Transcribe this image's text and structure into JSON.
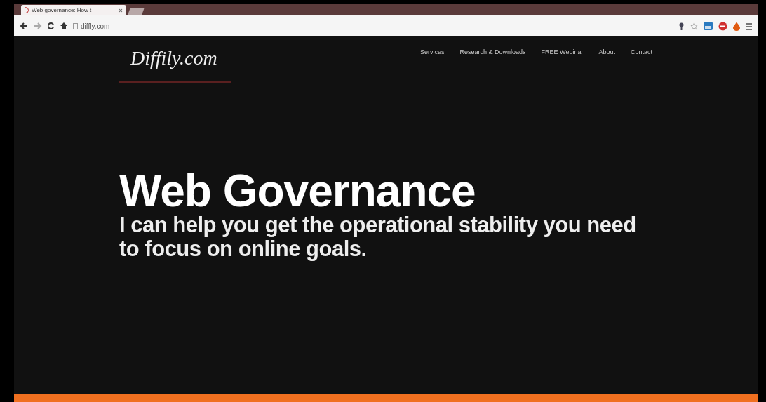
{
  "browser": {
    "tab_title": "Web governance: How t",
    "url": "diffly.com"
  },
  "site": {
    "logo": "Diffily.com",
    "nav": [
      {
        "label": "Services"
      },
      {
        "label": "Research & Downloads"
      },
      {
        "label": "FREE Webinar"
      },
      {
        "label": "About"
      },
      {
        "label": "Contact"
      }
    ],
    "headline": "Web Governance",
    "subhead": "I can help you get the operational stability you need to focus on online goals."
  }
}
